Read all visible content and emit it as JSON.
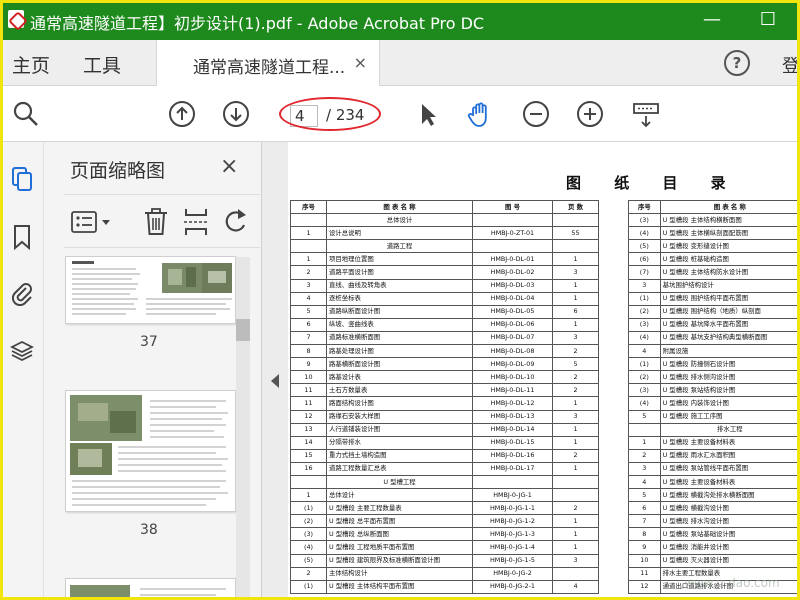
{
  "window": {
    "title": "通常高速隧道工程】初步设计(1).pdf - Adobe Acrobat Pro DC",
    "minimize": "—",
    "maximize": "☐"
  },
  "menu": {
    "home": "主页",
    "tools": "工具",
    "tab_label": "通常高速隧道工程...",
    "tab_close": "×",
    "help": "?",
    "login": "登"
  },
  "toolbar": {
    "current_page": "4",
    "total_pages": "/ 234"
  },
  "thumbnails": {
    "panel_title": "页面缩略图",
    "close": "×",
    "pages": [
      {
        "label": "37"
      },
      {
        "label": "38"
      }
    ]
  },
  "document": {
    "title": "图 纸 目 录",
    "headers": [
      "序号",
      "图 表 名 称",
      "图 号",
      "页 数"
    ],
    "left_rows": [
      {
        "no": "",
        "name": "总体设计",
        "code": "",
        "pages": "",
        "section": true
      },
      {
        "no": "1",
        "name": "设计总说明",
        "code": "HMBJ-0-ZT-01",
        "pages": "55"
      },
      {
        "no": "",
        "name": "道路工程",
        "code": "",
        "pages": "",
        "section": true
      },
      {
        "no": "1",
        "name": "项目地理位置图",
        "code": "HMBJ-0-DL-01",
        "pages": "1"
      },
      {
        "no": "2",
        "name": "道路平面设计图",
        "code": "HMBJ-0-DL-02",
        "pages": "3"
      },
      {
        "no": "3",
        "name": "直线、曲线及转角表",
        "code": "HMBJ-0-DL-03",
        "pages": "1"
      },
      {
        "no": "4",
        "name": "逐桩坐标表",
        "code": "HMBJ-0-DL-04",
        "pages": "1"
      },
      {
        "no": "5",
        "name": "道路纵断面设计图",
        "code": "HMBJ-0-DL-05",
        "pages": "6"
      },
      {
        "no": "6",
        "name": "纵坡、竖曲线表",
        "code": "HMBJ-0-DL-06",
        "pages": "1"
      },
      {
        "no": "7",
        "name": "道路标准横断面图",
        "code": "HMBJ-0-DL-07",
        "pages": "3"
      },
      {
        "no": "8",
        "name": "路基处理设计图",
        "code": "HMBJ-0-DL-08",
        "pages": "2"
      },
      {
        "no": "9",
        "name": "路基横断面设计图",
        "code": "HMBJ-0-DL-09",
        "pages": "5"
      },
      {
        "no": "10",
        "name": "路基设计表",
        "code": "HMBJ-0-DL-10",
        "pages": "2"
      },
      {
        "no": "11",
        "name": "土石方数量表",
        "code": "HMBJ-0-DL-11",
        "pages": "2"
      },
      {
        "no": "11",
        "name": "路面结构设计图",
        "code": "HMBJ-0-DL-12",
        "pages": "1"
      },
      {
        "no": "12",
        "name": "路缘石安装大样图",
        "code": "HMBJ-0-DL-13",
        "pages": "3"
      },
      {
        "no": "13",
        "name": "人行道铺装设计图",
        "code": "HMBJ-0-DL-14",
        "pages": "1"
      },
      {
        "no": "14",
        "name": "分隔带排水",
        "code": "HMBJ-0-DL-15",
        "pages": "1"
      },
      {
        "no": "15",
        "name": "重力式挡土墙构造图",
        "code": "HMBJ-0-DL-16",
        "pages": "2"
      },
      {
        "no": "16",
        "name": "道路工程数量汇总表",
        "code": "HMBJ-0-DL-17",
        "pages": "1"
      },
      {
        "no": "",
        "name": "U 型槽工程",
        "code": "",
        "pages": "",
        "section": true
      },
      {
        "no": "1",
        "name": "总体设计",
        "code": "HMBJ-0-JG-1",
        "pages": ""
      },
      {
        "no": "(1)",
        "name": "U 型槽段  主要工程数量表",
        "code": "HMBJ-0-JG-1-1",
        "pages": "2"
      },
      {
        "no": "(2)",
        "name": "U 型槽段  总平面布置图",
        "code": "HMBJ-0-JG-1-2",
        "pages": "1"
      },
      {
        "no": "(3)",
        "name": "U 型槽段  总纵断面图",
        "code": "HMBJ-0-JG-1-3",
        "pages": "1"
      },
      {
        "no": "(4)",
        "name": "U 型槽段  工程地质平面布置图",
        "code": "HMBJ-0-JG-1-4",
        "pages": "1"
      },
      {
        "no": "(5)",
        "name": "U 型槽段  建筑限界及标准横断面设计图",
        "code": "HMBJ-0-JG-1-5",
        "pages": "3"
      },
      {
        "no": "2",
        "name": "主体结构设计",
        "code": "HMBJ-0-JG-2",
        "pages": ""
      },
      {
        "no": "(1)",
        "name": "U 型槽段  主体结构平面布置图",
        "code": "HMBJ-0-JG-2-1",
        "pages": "4"
      }
    ],
    "right_rows": [
      {
        "no": "(3)",
        "name": "U 型槽段  主体结构横断面图"
      },
      {
        "no": "(4)",
        "name": "U 型槽段  主体横纵剖面配筋图"
      },
      {
        "no": "(5)",
        "name": "U 型槽段  变形缝设计图"
      },
      {
        "no": "(6)",
        "name": "U 型槽段  桩基础构造图"
      },
      {
        "no": "(7)",
        "name": "U 型槽段  主体结构防水设计图"
      },
      {
        "no": "3",
        "name": "基坑围护结构设计"
      },
      {
        "no": "(1)",
        "name": "U 型槽段  围护结构平面布置图"
      },
      {
        "no": "(2)",
        "name": "U 型槽段  围护结构（地质）纵剖面"
      },
      {
        "no": "(3)",
        "name": "U 型槽段  基坑降水平面布置图"
      },
      {
        "no": "(4)",
        "name": "U 型槽段  基坑支护结构典型横断面图"
      },
      {
        "no": "4",
        "name": "附属设施"
      },
      {
        "no": "(1)",
        "name": "U 型槽段  防撞侧石设计图"
      },
      {
        "no": "(2)",
        "name": "U 型槽段  排水侧沟设计图"
      },
      {
        "no": "(3)",
        "name": "U 型槽段  泵站结构设计图"
      },
      {
        "no": "(4)",
        "name": "U 型槽段  内装饰设计图"
      },
      {
        "no": "5",
        "name": "U 型槽段  施工工序图"
      },
      {
        "no": "",
        "name": "排水工程",
        "section": true
      },
      {
        "no": "1",
        "name": "U 型槽段  主要设备材料表"
      },
      {
        "no": "2",
        "name": "U 型槽段  雨水汇水面积图"
      },
      {
        "no": "3",
        "name": "U 型槽段  泵站管线平面布置图"
      },
      {
        "no": "4",
        "name": "U 型槽段  主要设备材料表"
      },
      {
        "no": "5",
        "name": "U 型槽段  横截沟处排水横断面图"
      },
      {
        "no": "6",
        "name": "U 型槽段  横截沟设计图"
      },
      {
        "no": "7",
        "name": "U 型槽段  排水沟设计图"
      },
      {
        "no": "8",
        "name": "U 型槽段  泵站基础设计图"
      },
      {
        "no": "9",
        "name": "U 型槽段  消能井设计图"
      },
      {
        "no": "10",
        "name": "U 型槽段  灭火器设计图"
      },
      {
        "no": "11",
        "name": "排水主要工程数量表"
      },
      {
        "no": "12",
        "name": "通道出口道路排水设计图"
      }
    ]
  },
  "watermark": "www.u-dao.com"
}
